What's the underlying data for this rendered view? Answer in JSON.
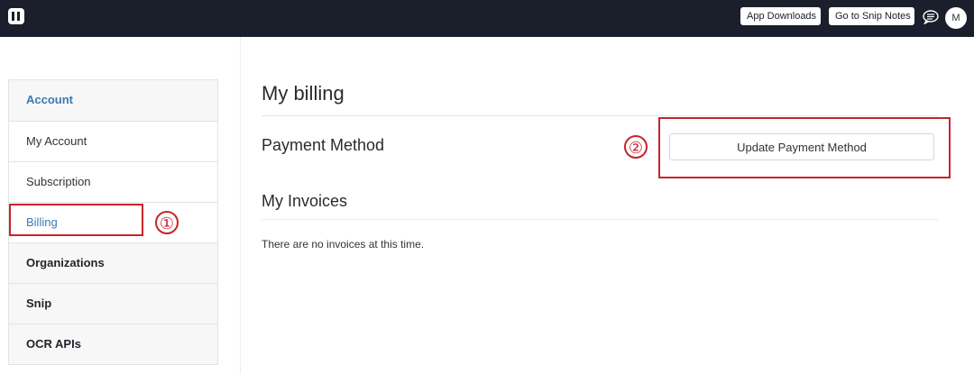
{
  "topbar": {
    "logo_icon": "mathpix-logo-icon",
    "downloads_label": "App Downloads",
    "snipnotes_label": "Go to Snip Notes",
    "chat_icon": "chat-icon",
    "avatar_initial": "M"
  },
  "sidebar": {
    "items": [
      {
        "label": "Account",
        "kind": "header"
      },
      {
        "label": "My Account",
        "kind": "link"
      },
      {
        "label": "Subscription",
        "kind": "link"
      },
      {
        "label": "Billing",
        "kind": "link",
        "active": true
      },
      {
        "label": "Organizations",
        "kind": "header"
      },
      {
        "label": "Snip",
        "kind": "header"
      },
      {
        "label": "OCR APIs",
        "kind": "header"
      }
    ]
  },
  "annotations": {
    "first": "①",
    "second": "②",
    "color": "#c8232b"
  },
  "main": {
    "title": "My billing",
    "payment_heading": "Payment Method",
    "update_button_label": "Update Payment Method",
    "invoices_heading": "My Invoices",
    "no_invoices_text": "There are no invoices at this time."
  },
  "colors": {
    "topbar_bg": "#1b1f2b",
    "accent_link": "#3a7bb5"
  }
}
